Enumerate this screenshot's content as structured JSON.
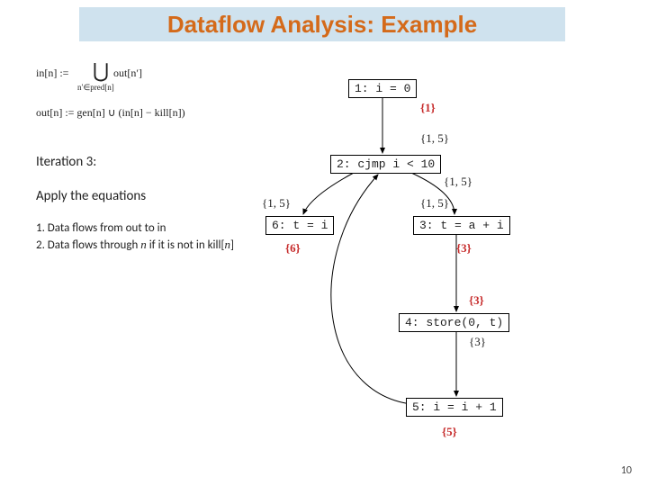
{
  "title": "Dataflow Analysis: Example",
  "eqn_in": "in[n] :=  ⋃  out[n′]",
  "eqn_in_sub": "n′∈pred[n]",
  "eqn_out": "out[n] := gen[n] ∪ (in[n] − kill[n])",
  "iteration_line": "Iteration 3:",
  "apply_line": "Apply the equations",
  "step1": "1. Data flows from out to in",
  "step2_a": "2. Data flows through ",
  "step2_n": "n",
  "step2_b": " if it is not in kill[",
  "step2_n2": "n",
  "step2_c": "]",
  "nodes": {
    "n1": "1: i = 0",
    "n2": "2: cjmp i < 10",
    "n3": "3: t = a + i",
    "n4": "4: store(0, t)",
    "n5": "5: i = i + 1",
    "n6": "6: t = i"
  },
  "sets": {
    "s1": "{1}",
    "s15a": "{1, 5}",
    "s15b": "{1, 5}",
    "s15c": "{1, 5}",
    "s15d": "{1, 5}",
    "s3a": "{3}",
    "s3b": "{3}",
    "s3c": "{3}",
    "s6": "{6}",
    "s5": "{5}"
  },
  "page_number": "10"
}
